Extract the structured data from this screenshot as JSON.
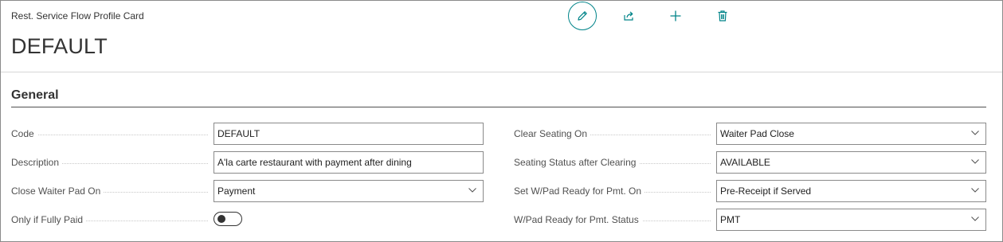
{
  "header": {
    "caption": "Rest. Service Flow Profile Card",
    "title": "DEFAULT"
  },
  "actions": [
    "pencil-icon",
    "share-icon",
    "plus-icon",
    "trash-icon"
  ],
  "accent_color": "#008489",
  "section": {
    "title": "General"
  },
  "left_fields": [
    {
      "label": "Code",
      "type": "text",
      "value": "DEFAULT"
    },
    {
      "label": "Description",
      "type": "text",
      "value": "A'la carte restaurant with payment after dining"
    },
    {
      "label": "Close Waiter Pad On",
      "type": "select",
      "value": "Payment"
    },
    {
      "label": "Only if Fully Paid",
      "type": "toggle",
      "value": "off"
    }
  ],
  "right_fields": [
    {
      "label": "Clear Seating On",
      "type": "select",
      "value": "Waiter Pad Close"
    },
    {
      "label": "Seating Status after Clearing",
      "type": "select",
      "value": "AVAILABLE"
    },
    {
      "label": "Set W/Pad Ready for Pmt. On",
      "type": "select",
      "value": "Pre-Receipt if Served"
    },
    {
      "label": "W/Pad Ready for Pmt. Status",
      "type": "select",
      "value": "PMT"
    }
  ]
}
